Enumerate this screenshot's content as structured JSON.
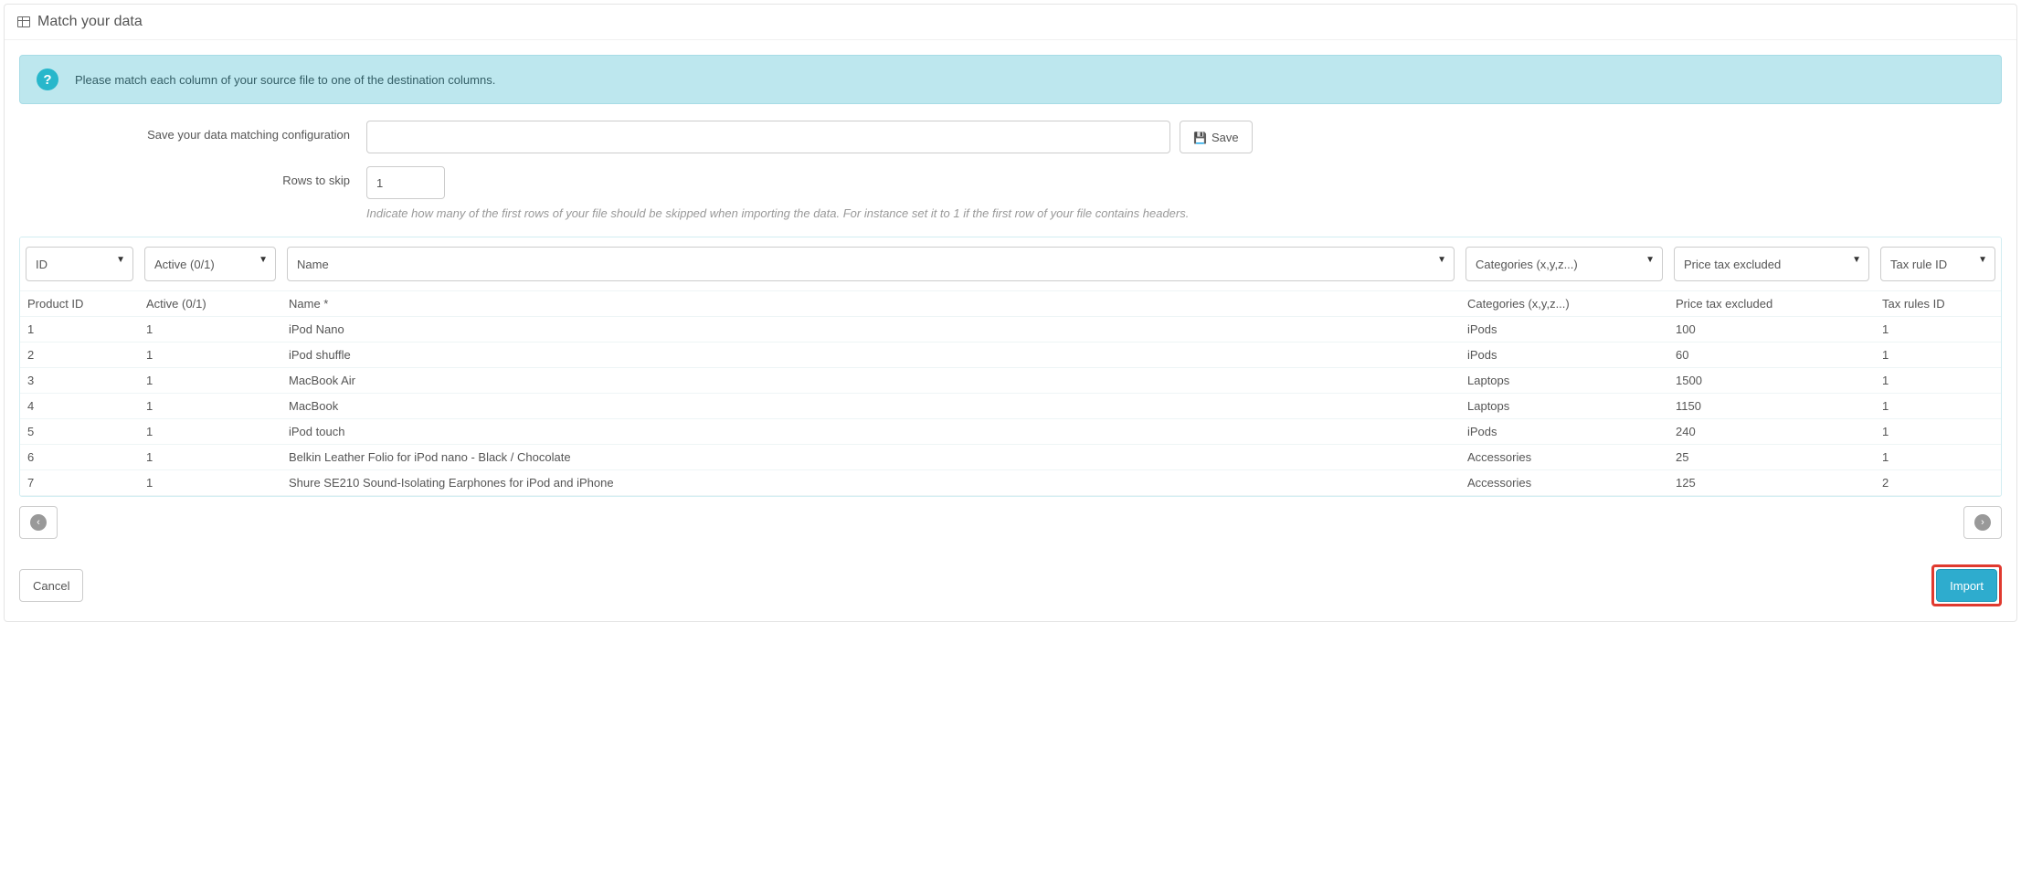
{
  "header": {
    "title": "Match your data"
  },
  "alert": {
    "text": "Please match each column of your source file to one of the destination columns."
  },
  "form": {
    "config_label": "Save your data matching configuration",
    "config_value": "",
    "save_label": "Save",
    "rows_label": "Rows to skip",
    "rows_value": "1",
    "rows_help": "Indicate how many of the first rows of your file should be skipped when importing the data. For instance set it to 1 if the first row of your file contains headers."
  },
  "columns": {
    "selectors": [
      "ID",
      "Active (0/1)",
      "Name",
      "Categories (x,y,z...)",
      "Price tax excluded",
      "Tax rule ID"
    ],
    "headers": [
      "Product ID",
      "Active (0/1)",
      "Name *",
      "Categories (x,y,z...)",
      "Price tax excluded",
      "Tax rules ID"
    ]
  },
  "rows": [
    {
      "id": "1",
      "active": "1",
      "name": "iPod Nano",
      "cat": "iPods",
      "price": "100",
      "tax": "1"
    },
    {
      "id": "2",
      "active": "1",
      "name": "iPod shuffle",
      "cat": "iPods",
      "price": "60",
      "tax": "1"
    },
    {
      "id": "3",
      "active": "1",
      "name": "MacBook Air",
      "cat": "Laptops",
      "price": "1500",
      "tax": "1"
    },
    {
      "id": "4",
      "active": "1",
      "name": "MacBook",
      "cat": "Laptops",
      "price": "1150",
      "tax": "1"
    },
    {
      "id": "5",
      "active": "1",
      "name": "iPod touch",
      "cat": "iPods",
      "price": "240",
      "tax": "1"
    },
    {
      "id": "6",
      "active": "1",
      "name": "Belkin Leather Folio for iPod nano - Black / Chocolate",
      "cat": "Accessories",
      "price": "25",
      "tax": "1"
    },
    {
      "id": "7",
      "active": "1",
      "name": "Shure SE210 Sound-Isolating Earphones for iPod and iPhone",
      "cat": "Accessories",
      "price": "125",
      "tax": "2"
    }
  ],
  "footer": {
    "cancel": "Cancel",
    "import": "Import"
  }
}
